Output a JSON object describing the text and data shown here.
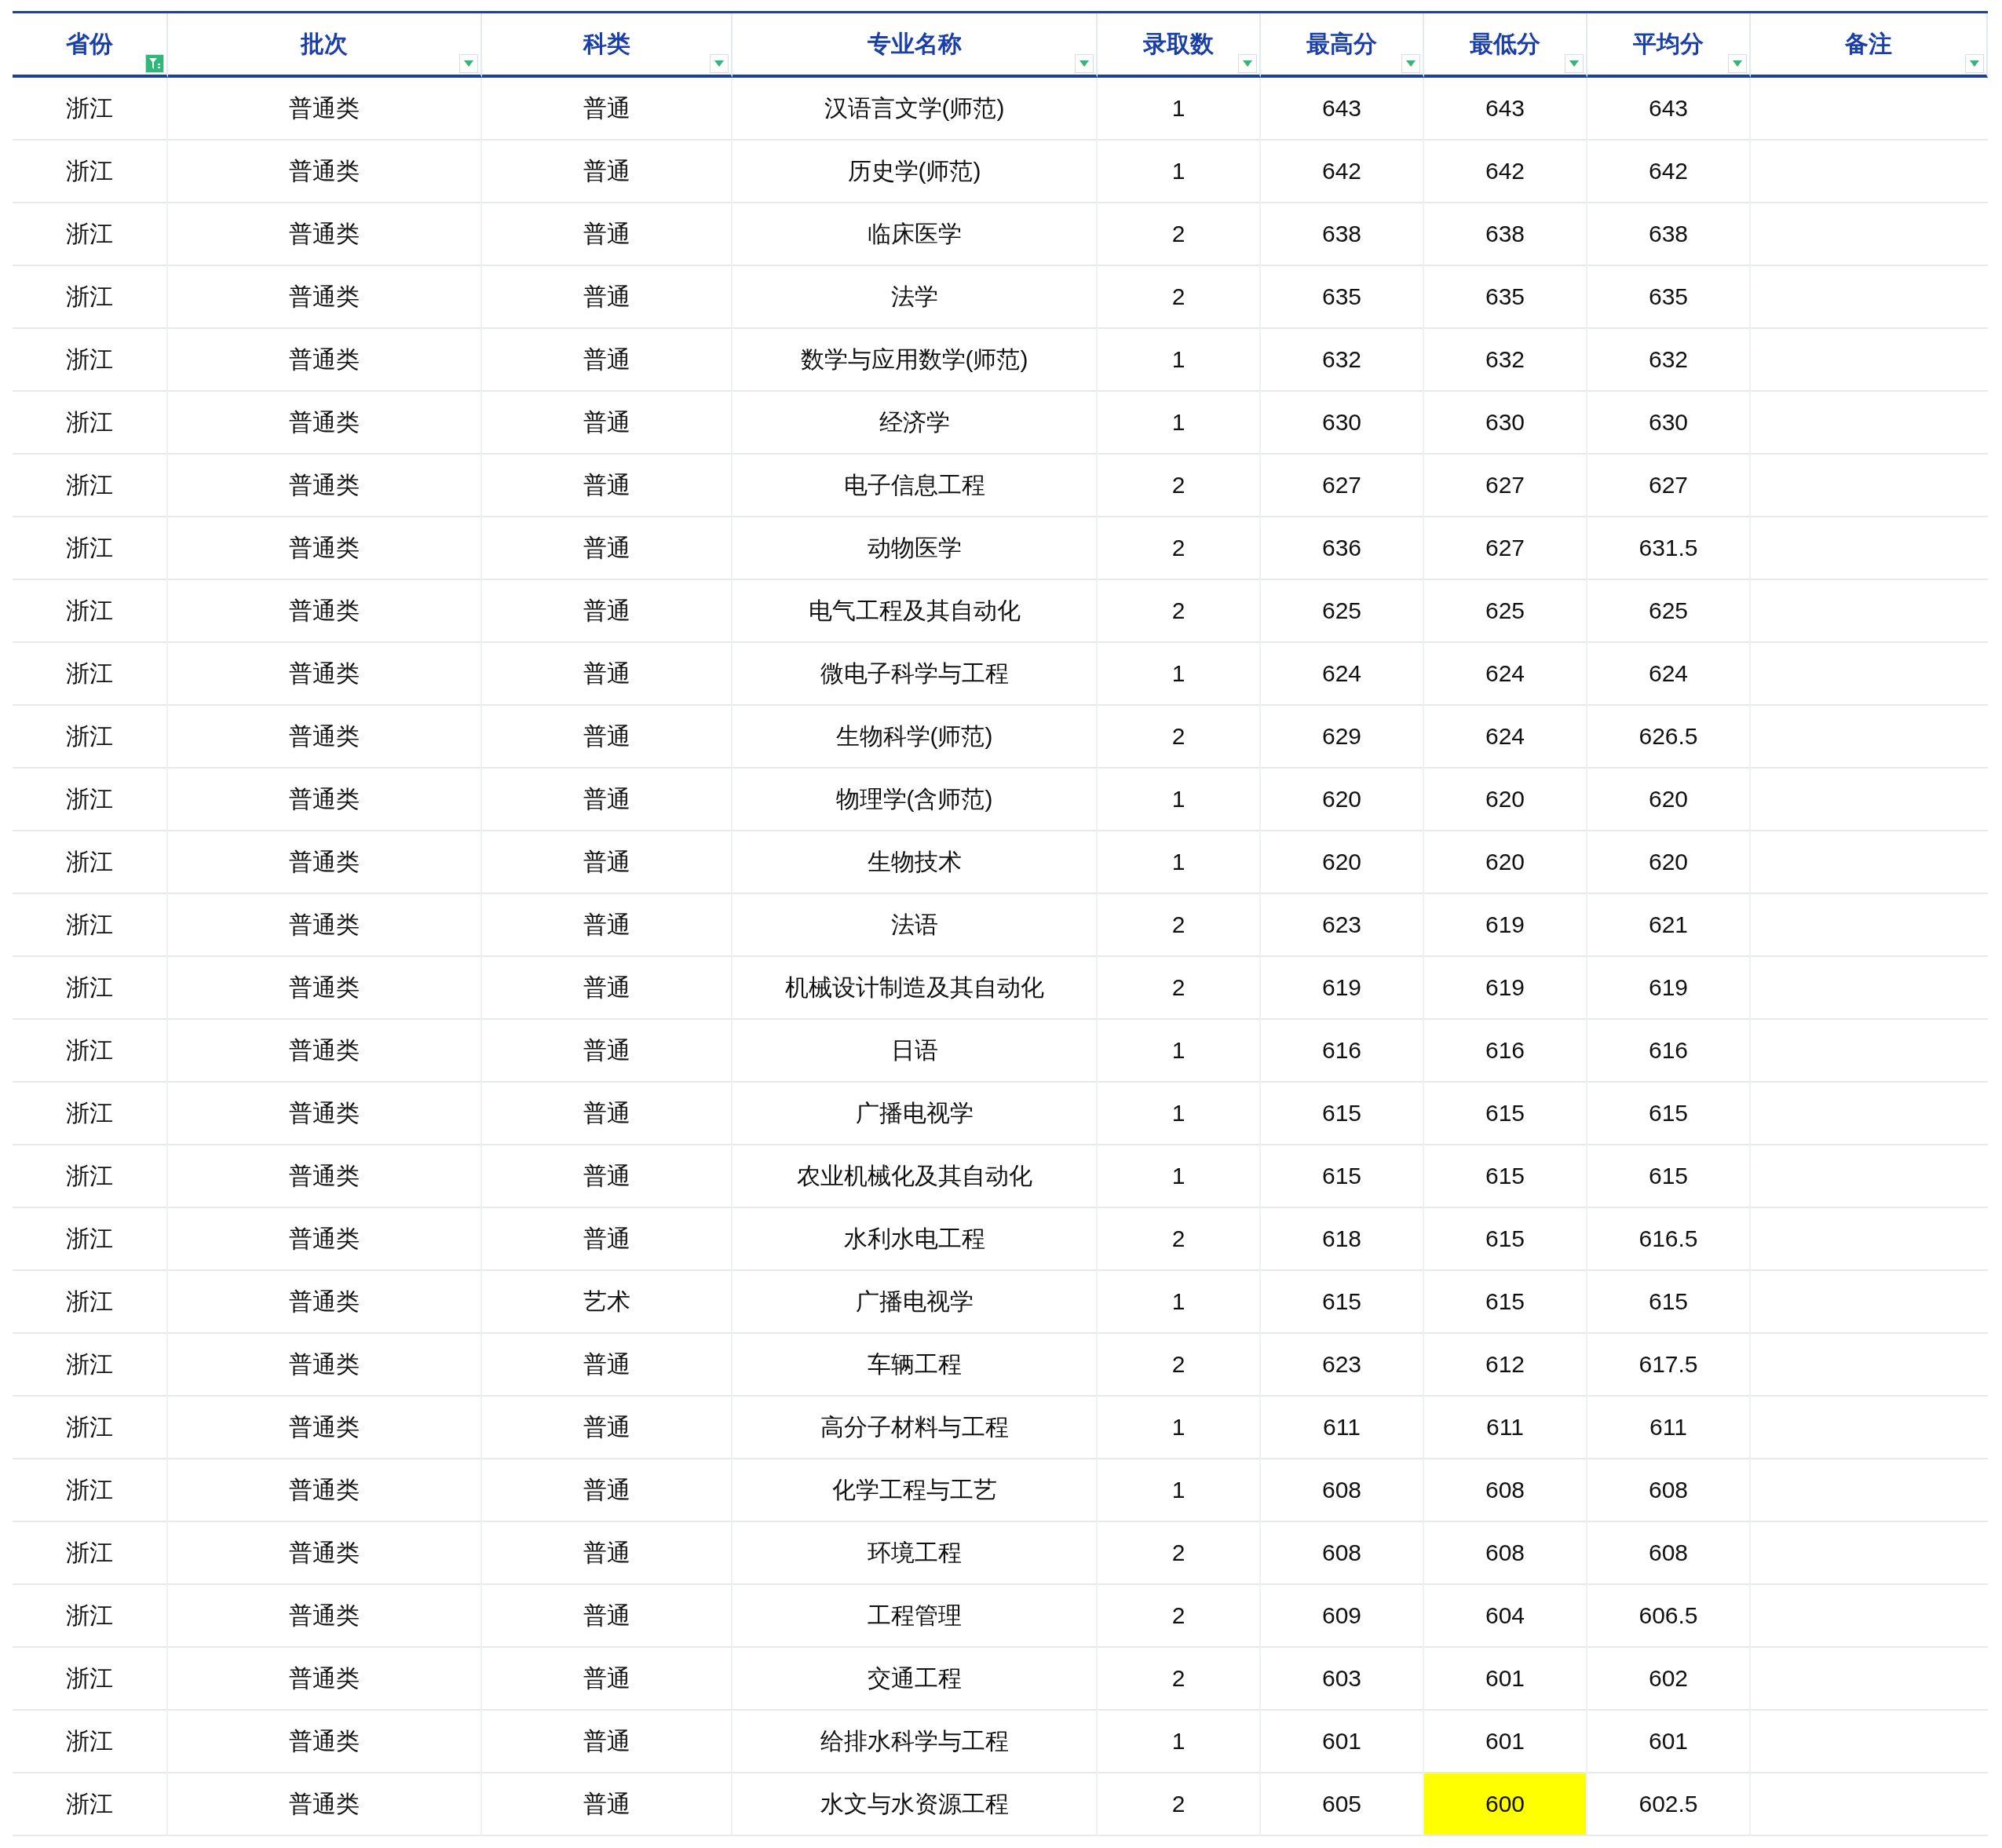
{
  "columns": [
    {
      "label": "省份",
      "filter_active": true
    },
    {
      "label": "批次",
      "filter_active": false
    },
    {
      "label": "科类",
      "filter_active": false
    },
    {
      "label": "专业名称",
      "filter_active": false
    },
    {
      "label": "录取数",
      "filter_active": false
    },
    {
      "label": "最高分",
      "filter_active": false
    },
    {
      "label": "最低分",
      "filter_active": false
    },
    {
      "label": "平均分",
      "filter_active": false
    },
    {
      "label": "备注",
      "filter_active": false
    }
  ],
  "rows": [
    [
      {
        "text": "浙江",
        "highlighted": false
      },
      {
        "text": "普通类",
        "highlighted": false
      },
      {
        "text": "普通",
        "highlighted": false
      },
      {
        "text": "汉语言文学(师范)",
        "highlighted": false
      },
      {
        "text": "1",
        "highlighted": false
      },
      {
        "text": "643",
        "highlighted": false
      },
      {
        "text": "643",
        "highlighted": false
      },
      {
        "text": "643",
        "highlighted": false
      }
    ],
    [
      {
        "text": "浙江",
        "highlighted": false
      },
      {
        "text": "普通类",
        "highlighted": false
      },
      {
        "text": "普通",
        "highlighted": false
      },
      {
        "text": "历史学(师范)",
        "highlighted": false
      },
      {
        "text": "1",
        "highlighted": false
      },
      {
        "text": "642",
        "highlighted": false
      },
      {
        "text": "642",
        "highlighted": false
      },
      {
        "text": "642",
        "highlighted": false
      }
    ],
    [
      {
        "text": "浙江",
        "highlighted": false
      },
      {
        "text": "普通类",
        "highlighted": false
      },
      {
        "text": "普通",
        "highlighted": false
      },
      {
        "text": "临床医学",
        "highlighted": false
      },
      {
        "text": "2",
        "highlighted": false
      },
      {
        "text": "638",
        "highlighted": false
      },
      {
        "text": "638",
        "highlighted": false
      },
      {
        "text": "638",
        "highlighted": false
      }
    ],
    [
      {
        "text": "浙江",
        "highlighted": false
      },
      {
        "text": "普通类",
        "highlighted": false
      },
      {
        "text": "普通",
        "highlighted": false
      },
      {
        "text": "法学",
        "highlighted": false
      },
      {
        "text": "2",
        "highlighted": false
      },
      {
        "text": "635",
        "highlighted": false
      },
      {
        "text": "635",
        "highlighted": false
      },
      {
        "text": "635",
        "highlighted": false
      }
    ],
    [
      {
        "text": "浙江",
        "highlighted": false
      },
      {
        "text": "普通类",
        "highlighted": false
      },
      {
        "text": "普通",
        "highlighted": false
      },
      {
        "text": "数学与应用数学(师范)",
        "highlighted": false
      },
      {
        "text": "1",
        "highlighted": false
      },
      {
        "text": "632",
        "highlighted": false
      },
      {
        "text": "632",
        "highlighted": false
      },
      {
        "text": "632",
        "highlighted": false
      }
    ],
    [
      {
        "text": "浙江",
        "highlighted": false
      },
      {
        "text": "普通类",
        "highlighted": false
      },
      {
        "text": "普通",
        "highlighted": false
      },
      {
        "text": "经济学",
        "highlighted": false
      },
      {
        "text": "1",
        "highlighted": false
      },
      {
        "text": "630",
        "highlighted": false
      },
      {
        "text": "630",
        "highlighted": false
      },
      {
        "text": "630",
        "highlighted": false
      }
    ],
    [
      {
        "text": "浙江",
        "highlighted": false
      },
      {
        "text": "普通类",
        "highlighted": false
      },
      {
        "text": "普通",
        "highlighted": false
      },
      {
        "text": "电子信息工程",
        "highlighted": false
      },
      {
        "text": "2",
        "highlighted": false
      },
      {
        "text": "627",
        "highlighted": false
      },
      {
        "text": "627",
        "highlighted": false
      },
      {
        "text": "627",
        "highlighted": false
      }
    ],
    [
      {
        "text": "浙江",
        "highlighted": false
      },
      {
        "text": "普通类",
        "highlighted": false
      },
      {
        "text": "普通",
        "highlighted": false
      },
      {
        "text": "动物医学",
        "highlighted": false
      },
      {
        "text": "2",
        "highlighted": false
      },
      {
        "text": "636",
        "highlighted": false
      },
      {
        "text": "627",
        "highlighted": false
      },
      {
        "text": "631.5",
        "highlighted": false
      }
    ],
    [
      {
        "text": "浙江",
        "highlighted": false
      },
      {
        "text": "普通类",
        "highlighted": false
      },
      {
        "text": "普通",
        "highlighted": false
      },
      {
        "text": "电气工程及其自动化",
        "highlighted": false
      },
      {
        "text": "2",
        "highlighted": false
      },
      {
        "text": "625",
        "highlighted": false
      },
      {
        "text": "625",
        "highlighted": false
      },
      {
        "text": "625",
        "highlighted": false
      }
    ],
    [
      {
        "text": "浙江",
        "highlighted": false
      },
      {
        "text": "普通类",
        "highlighted": false
      },
      {
        "text": "普通",
        "highlighted": false
      },
      {
        "text": "微电子科学与工程",
        "highlighted": false
      },
      {
        "text": "1",
        "highlighted": false
      },
      {
        "text": "624",
        "highlighted": false
      },
      {
        "text": "624",
        "highlighted": false
      },
      {
        "text": "624",
        "highlighted": false
      }
    ],
    [
      {
        "text": "浙江",
        "highlighted": false
      },
      {
        "text": "普通类",
        "highlighted": false
      },
      {
        "text": "普通",
        "highlighted": false
      },
      {
        "text": "生物科学(师范)",
        "highlighted": false
      },
      {
        "text": "2",
        "highlighted": false
      },
      {
        "text": "629",
        "highlighted": false
      },
      {
        "text": "624",
        "highlighted": false
      },
      {
        "text": "626.5",
        "highlighted": false
      }
    ],
    [
      {
        "text": "浙江",
        "highlighted": false
      },
      {
        "text": "普通类",
        "highlighted": false
      },
      {
        "text": "普通",
        "highlighted": false
      },
      {
        "text": "物理学(含师范)",
        "highlighted": false
      },
      {
        "text": "1",
        "highlighted": false
      },
      {
        "text": "620",
        "highlighted": false
      },
      {
        "text": "620",
        "highlighted": false
      },
      {
        "text": "620",
        "highlighted": false
      }
    ],
    [
      {
        "text": "浙江",
        "highlighted": false
      },
      {
        "text": "普通类",
        "highlighted": false
      },
      {
        "text": "普通",
        "highlighted": false
      },
      {
        "text": "生物技术",
        "highlighted": false
      },
      {
        "text": "1",
        "highlighted": false
      },
      {
        "text": "620",
        "highlighted": false
      },
      {
        "text": "620",
        "highlighted": false
      },
      {
        "text": "620",
        "highlighted": false
      }
    ],
    [
      {
        "text": "浙江",
        "highlighted": false
      },
      {
        "text": "普通类",
        "highlighted": false
      },
      {
        "text": "普通",
        "highlighted": false
      },
      {
        "text": "法语",
        "highlighted": false
      },
      {
        "text": "2",
        "highlighted": false
      },
      {
        "text": "623",
        "highlighted": false
      },
      {
        "text": "619",
        "highlighted": false
      },
      {
        "text": "621",
        "highlighted": false
      }
    ],
    [
      {
        "text": "浙江",
        "highlighted": false
      },
      {
        "text": "普通类",
        "highlighted": false
      },
      {
        "text": "普通",
        "highlighted": false
      },
      {
        "text": "机械设计制造及其自动化",
        "highlighted": false
      },
      {
        "text": "2",
        "highlighted": false
      },
      {
        "text": "619",
        "highlighted": false
      },
      {
        "text": "619",
        "highlighted": false
      },
      {
        "text": "619",
        "highlighted": false
      }
    ],
    [
      {
        "text": "浙江",
        "highlighted": false
      },
      {
        "text": "普通类",
        "highlighted": false
      },
      {
        "text": "普通",
        "highlighted": false
      },
      {
        "text": "日语",
        "highlighted": false
      },
      {
        "text": "1",
        "highlighted": false
      },
      {
        "text": "616",
        "highlighted": false
      },
      {
        "text": "616",
        "highlighted": false
      },
      {
        "text": "616",
        "highlighted": false
      }
    ],
    [
      {
        "text": "浙江",
        "highlighted": false
      },
      {
        "text": "普通类",
        "highlighted": false
      },
      {
        "text": "普通",
        "highlighted": false
      },
      {
        "text": "广播电视学",
        "highlighted": false
      },
      {
        "text": "1",
        "highlighted": false
      },
      {
        "text": "615",
        "highlighted": false
      },
      {
        "text": "615",
        "highlighted": false
      },
      {
        "text": "615",
        "highlighted": false
      }
    ],
    [
      {
        "text": "浙江",
        "highlighted": false
      },
      {
        "text": "普通类",
        "highlighted": false
      },
      {
        "text": "普通",
        "highlighted": false
      },
      {
        "text": "农业机械化及其自动化",
        "highlighted": false
      },
      {
        "text": "1",
        "highlighted": false
      },
      {
        "text": "615",
        "highlighted": false
      },
      {
        "text": "615",
        "highlighted": false
      },
      {
        "text": "615",
        "highlighted": false
      }
    ],
    [
      {
        "text": "浙江",
        "highlighted": false
      },
      {
        "text": "普通类",
        "highlighted": false
      },
      {
        "text": "普通",
        "highlighted": false
      },
      {
        "text": "水利水电工程",
        "highlighted": false
      },
      {
        "text": "2",
        "highlighted": false
      },
      {
        "text": "618",
        "highlighted": false
      },
      {
        "text": "615",
        "highlighted": false
      },
      {
        "text": "616.5",
        "highlighted": false
      }
    ],
    [
      {
        "text": "浙江",
        "highlighted": false
      },
      {
        "text": "普通类",
        "highlighted": false
      },
      {
        "text": "艺术",
        "highlighted": false
      },
      {
        "text": "广播电视学",
        "highlighted": false
      },
      {
        "text": "1",
        "highlighted": false
      },
      {
        "text": "615",
        "highlighted": false
      },
      {
        "text": "615",
        "highlighted": false
      },
      {
        "text": "615",
        "highlighted": false
      }
    ],
    [
      {
        "text": "浙江",
        "highlighted": false
      },
      {
        "text": "普通类",
        "highlighted": false
      },
      {
        "text": "普通",
        "highlighted": false
      },
      {
        "text": "车辆工程",
        "highlighted": false
      },
      {
        "text": "2",
        "highlighted": false
      },
      {
        "text": "623",
        "highlighted": false
      },
      {
        "text": "612",
        "highlighted": false
      },
      {
        "text": "617.5",
        "highlighted": false
      }
    ],
    [
      {
        "text": "浙江",
        "highlighted": false
      },
      {
        "text": "普通类",
        "highlighted": false
      },
      {
        "text": "普通",
        "highlighted": false
      },
      {
        "text": "高分子材料与工程",
        "highlighted": false
      },
      {
        "text": "1",
        "highlighted": false
      },
      {
        "text": "611",
        "highlighted": false
      },
      {
        "text": "611",
        "highlighted": false
      },
      {
        "text": "611",
        "highlighted": false
      }
    ],
    [
      {
        "text": "浙江",
        "highlighted": false
      },
      {
        "text": "普通类",
        "highlighted": false
      },
      {
        "text": "普通",
        "highlighted": false
      },
      {
        "text": "化学工程与工艺",
        "highlighted": false
      },
      {
        "text": "1",
        "highlighted": false
      },
      {
        "text": "608",
        "highlighted": false
      },
      {
        "text": "608",
        "highlighted": false
      },
      {
        "text": "608",
        "highlighted": false
      }
    ],
    [
      {
        "text": "浙江",
        "highlighted": false
      },
      {
        "text": "普通类",
        "highlighted": false
      },
      {
        "text": "普通",
        "highlighted": false
      },
      {
        "text": "环境工程",
        "highlighted": false
      },
      {
        "text": "2",
        "highlighted": false
      },
      {
        "text": "608",
        "highlighted": false
      },
      {
        "text": "608",
        "highlighted": false
      },
      {
        "text": "608",
        "highlighted": false
      }
    ],
    [
      {
        "text": "浙江",
        "highlighted": false
      },
      {
        "text": "普通类",
        "highlighted": false
      },
      {
        "text": "普通",
        "highlighted": false
      },
      {
        "text": "工程管理",
        "highlighted": false
      },
      {
        "text": "2",
        "highlighted": false
      },
      {
        "text": "609",
        "highlighted": false
      },
      {
        "text": "604",
        "highlighted": false
      },
      {
        "text": "606.5",
        "highlighted": false
      }
    ],
    [
      {
        "text": "浙江",
        "highlighted": false
      },
      {
        "text": "普通类",
        "highlighted": false
      },
      {
        "text": "普通",
        "highlighted": false
      },
      {
        "text": "交通工程",
        "highlighted": false
      },
      {
        "text": "2",
        "highlighted": false
      },
      {
        "text": "603",
        "highlighted": false
      },
      {
        "text": "601",
        "highlighted": false
      },
      {
        "text": "602",
        "highlighted": false
      }
    ],
    [
      {
        "text": "浙江",
        "highlighted": false
      },
      {
        "text": "普通类",
        "highlighted": false
      },
      {
        "text": "普通",
        "highlighted": false
      },
      {
        "text": "给排水科学与工程",
        "highlighted": false
      },
      {
        "text": "1",
        "highlighted": false
      },
      {
        "text": "601",
        "highlighted": false
      },
      {
        "text": "601",
        "highlighted": false
      },
      {
        "text": "601",
        "highlighted": false
      }
    ],
    [
      {
        "text": "浙江",
        "highlighted": false
      },
      {
        "text": "普通类",
        "highlighted": false
      },
      {
        "text": "普通",
        "highlighted": false
      },
      {
        "text": "水文与水资源工程",
        "highlighted": false
      },
      {
        "text": "2",
        "highlighted": false
      },
      {
        "text": "605",
        "highlighted": false
      },
      {
        "text": "600",
        "highlighted": true
      },
      {
        "text": "602.5",
        "highlighted": false
      }
    ]
  ]
}
